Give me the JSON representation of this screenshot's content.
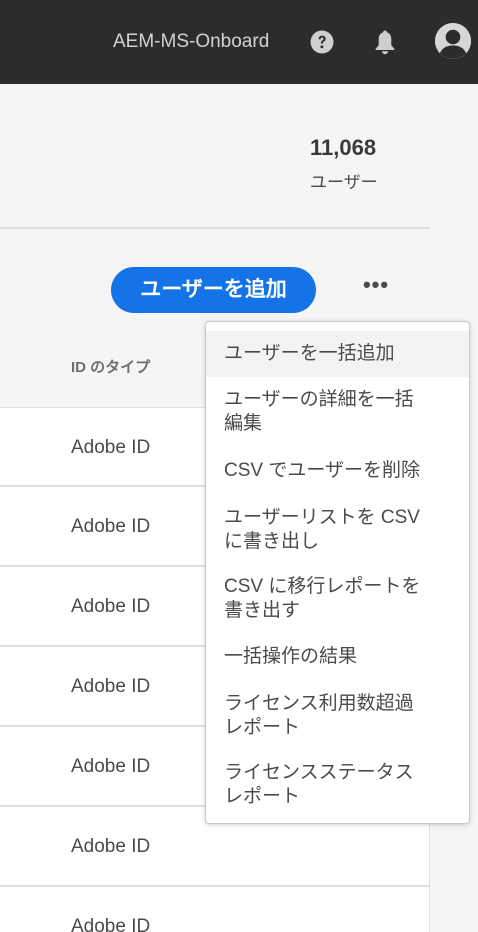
{
  "header": {
    "org_name": "AEM-MS-Onboard",
    "icons": [
      "help-icon",
      "bell-icon",
      "avatar-icon"
    ]
  },
  "stats": {
    "user_count": "11,068",
    "user_label": "ユーザー"
  },
  "toolbar": {
    "add_user_label": "ユーザーを追加",
    "more_label": "•••"
  },
  "table": {
    "column_id_type": "ID のタイプ",
    "rows": [
      {
        "id_type": "Adobe ID"
      },
      {
        "id_type": "Adobe ID"
      },
      {
        "id_type": "Adobe ID"
      },
      {
        "id_type": "Adobe ID"
      },
      {
        "id_type": "Adobe ID"
      },
      {
        "id_type": "Adobe ID"
      },
      {
        "id_type": "Adobe ID"
      }
    ]
  },
  "menu": {
    "items": [
      {
        "label": "ユーザーを一括追加"
      },
      {
        "label": "ユーザーの詳細を一括\n編集"
      },
      {
        "label": "CSV でユーザーを削除"
      },
      {
        "label": "ユーザーリストを CSV\nに書き出し"
      },
      {
        "label": "CSV に移行レポートを\n書き出す"
      },
      {
        "label": "一括操作の結果"
      },
      {
        "label": "ライセンス利用数超過\nレポート"
      },
      {
        "label": "ライセンスステータス\nレポート"
      }
    ]
  },
  "colors": {
    "topbar": "#2c2c2c",
    "accent": "#1473e6"
  }
}
